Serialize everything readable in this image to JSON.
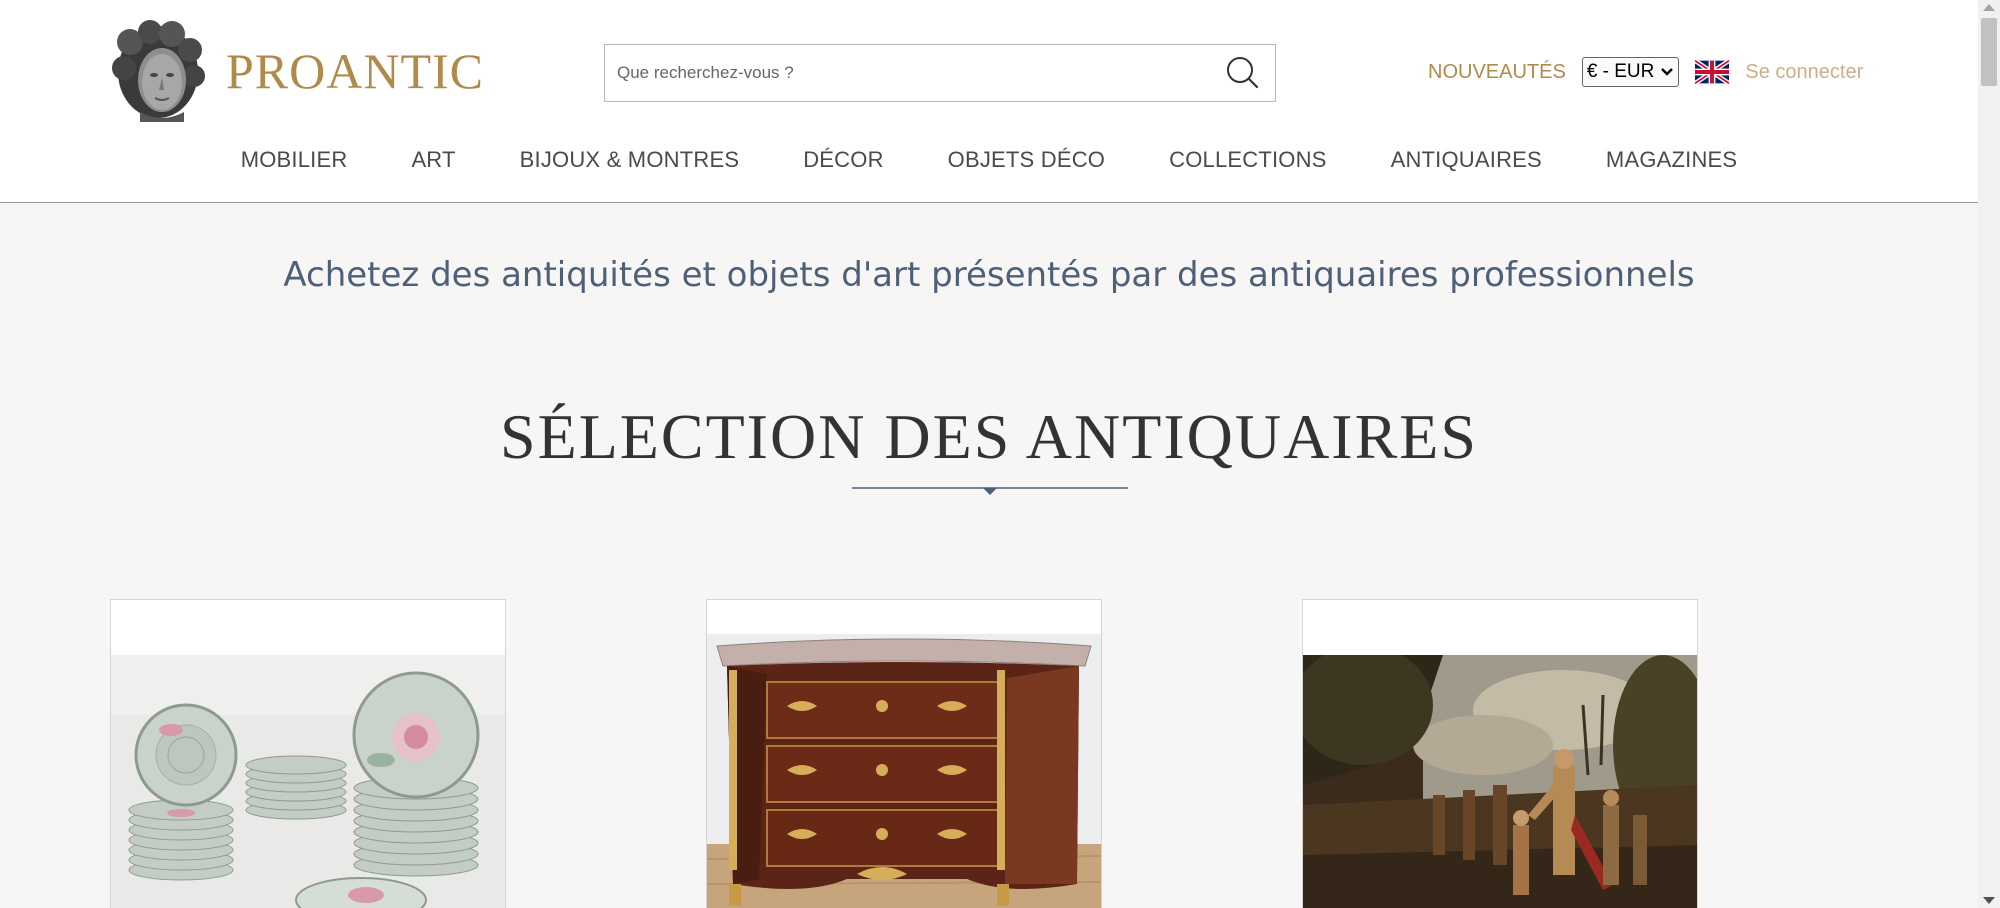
{
  "header": {
    "logo_text": "PROANTIC",
    "logo_icon": "antique-bust-icon",
    "search": {
      "placeholder": "Que recherchez-vous ?",
      "value": ""
    },
    "nouveautes_label": "NOUVEAUTÉS",
    "currency_selected": "€ - EUR",
    "language_flag": "uk-flag-icon",
    "login_label": "Se connecter"
  },
  "nav": {
    "items": [
      "MOBILIER",
      "ART",
      "BIJOUX & MONTRES",
      "DÉCOR",
      "OBJETS DÉCO",
      "COLLECTIONS",
      "ANTIQUAIRES",
      "MAGAZINES"
    ]
  },
  "main": {
    "tagline": "Achetez des antiquités et objets d'art présentés par des antiquaires professionnels",
    "section_title": "SÉLECTION DES ANTIQUAIRES"
  },
  "products": [
    {
      "subject": "porcelain-plates-set"
    },
    {
      "subject": "louis-xv-commode"
    },
    {
      "subject": "old-master-painting"
    }
  ],
  "colors": {
    "brand_gold": "#b08a4a",
    "tagline_blue": "#4d6079",
    "page_bg": "#f7f6f4"
  }
}
